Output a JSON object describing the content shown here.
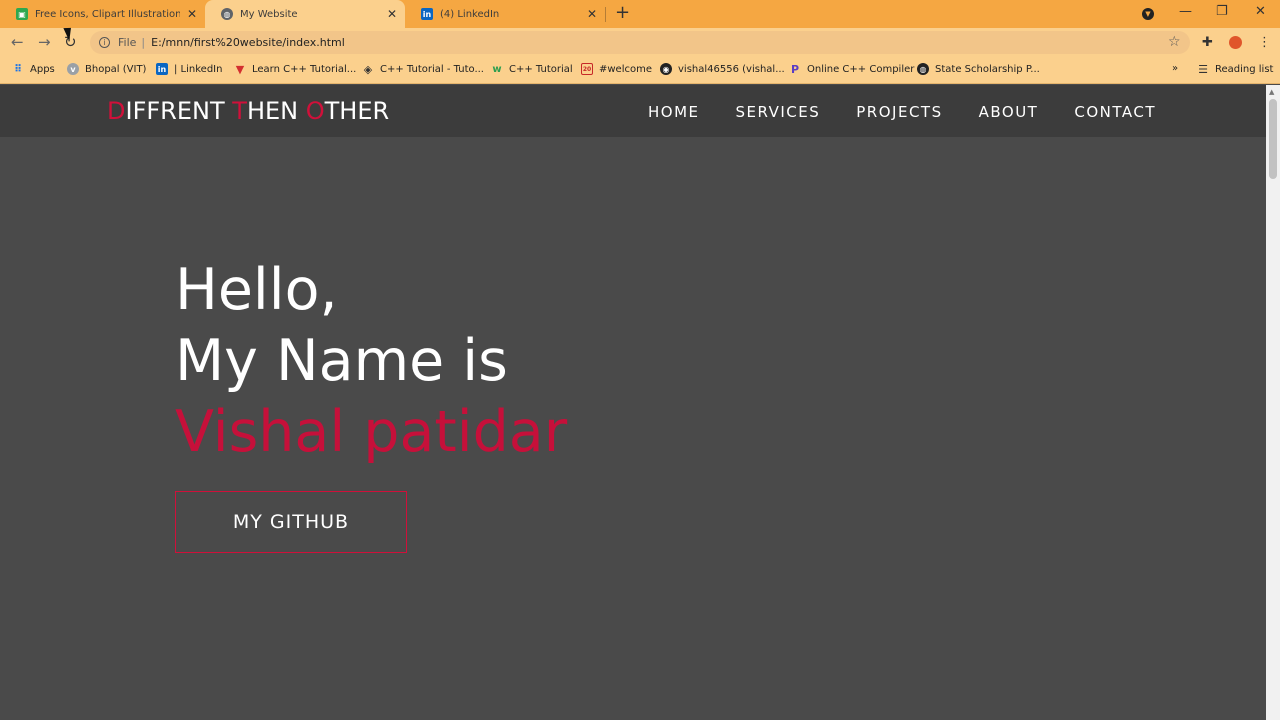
{
  "browser": {
    "tabs": [
      {
        "title": "Free Icons, Clipart Illustrations, Ph",
        "favicon": "green-square-icon",
        "active": false
      },
      {
        "title": "My Website",
        "favicon": "globe-icon",
        "active": true
      },
      {
        "title": "(4) LinkedIn",
        "favicon": "linkedin-icon",
        "active": false
      }
    ],
    "address": {
      "scheme": "File",
      "url": "E:/mnn/first%20website/index.html"
    },
    "bookmarks": [
      {
        "label": "Apps",
        "icon": "apps-grid-icon"
      },
      {
        "label": "Bhopal (VIT)",
        "icon": "vit-icon"
      },
      {
        "label": "| LinkedIn",
        "icon": "linkedin-icon"
      },
      {
        "label": "Learn C++ Tutorial...",
        "icon": "v-logo-icon"
      },
      {
        "label": "C++ Tutorial - Tuto...",
        "icon": "diamond-icon"
      },
      {
        "label": "C++ Tutorial",
        "icon": "w3-icon"
      },
      {
        "label": "#welcome",
        "icon": "calendar-icon"
      },
      {
        "label": "vishal46556 (vishal...",
        "icon": "github-icon"
      },
      {
        "label": "Online C++ Compiler",
        "icon": "p-logo-icon"
      },
      {
        "label": "State Scholarship P...",
        "icon": "globe-icon"
      }
    ],
    "reading_list": "Reading list",
    "overflow": "»",
    "colors": {
      "tabstrip": "#f5a742",
      "toolbar": "#fbd08d"
    }
  },
  "site": {
    "brand": {
      "parts": [
        {
          "text": "D",
          "accent": true
        },
        {
          "text": "IFFRENT ",
          "accent": false
        },
        {
          "text": "T",
          "accent": true
        },
        {
          "text": "HEN ",
          "accent": false
        },
        {
          "text": "O",
          "accent": true
        },
        {
          "text": "THER",
          "accent": false
        }
      ]
    },
    "menu": [
      "HOME",
      "SERVICES",
      "PROJECTS",
      "ABOUT",
      "CONTACT"
    ],
    "hero": {
      "greeting": "Hello,",
      "intro": "My Name is",
      "name": "Vishal patidar"
    },
    "button": "MY GITHUB",
    "colors": {
      "accent": "#d0103a",
      "background": "#4a4a4a",
      "nav": "#3c3c3c"
    }
  }
}
